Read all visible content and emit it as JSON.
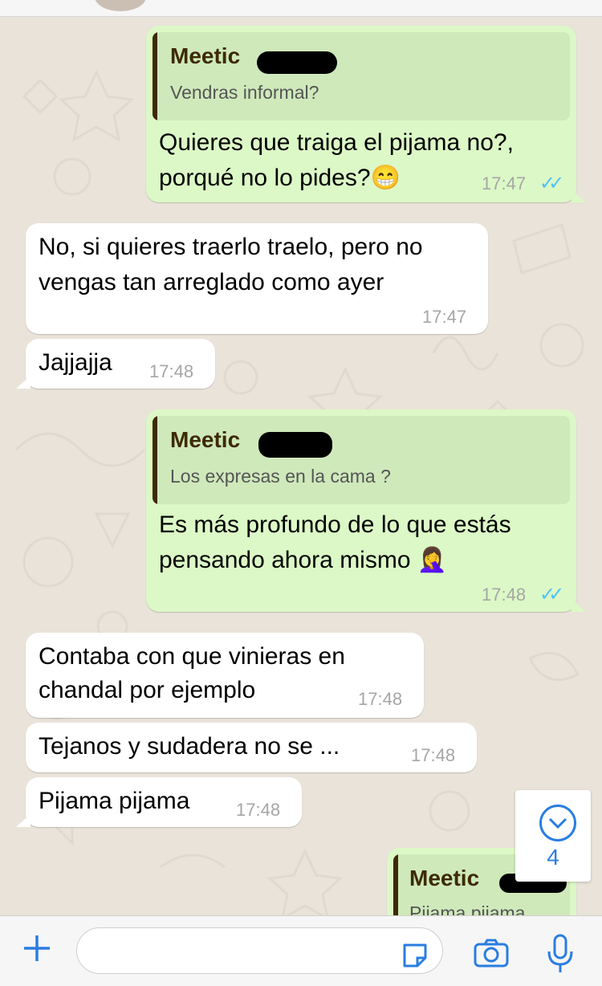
{
  "chat": {
    "messages": [
      {
        "direction": "out",
        "quote": {
          "author": "Meetic",
          "text": "Vendras informal?"
        },
        "lines": [
          "Quieres que traiga el pijama no?,",
          "porqué no lo pides?😁"
        ],
        "time": "17:47",
        "status_icon": "double-check-read"
      },
      {
        "direction": "in",
        "lines": [
          "No, si quieres traerlo traelo, pero no",
          "vengas tan arreglado como ayer"
        ],
        "time": "17:47"
      },
      {
        "direction": "in",
        "lines": [
          "Jajjajja"
        ],
        "time": "17:48"
      },
      {
        "direction": "out",
        "quote": {
          "author": "Meetic",
          "text": "Los expresas en la cama ?"
        },
        "lines": [
          "Es más profundo de lo que estás",
          "pensando ahora mismo 🤦‍♀️"
        ],
        "time": "17:48",
        "status_icon": "double-check-read"
      },
      {
        "direction": "in",
        "lines": [
          "Contaba con que vinieras en",
          "chandal por ejemplo"
        ],
        "time": "17:48"
      },
      {
        "direction": "in",
        "lines": [
          "Tejanos y sudadera no se ..."
        ],
        "time": "17:48"
      },
      {
        "direction": "in",
        "lines": [
          "Pijama pijama"
        ],
        "time": "17:48"
      },
      {
        "direction": "out",
        "quote": {
          "author": "Meetic",
          "text": "Pijama pijama"
        }
      }
    ],
    "scroll_down": {
      "icon": "chevron-down-icon",
      "unread_count": "4"
    },
    "colors": {
      "outgoing_bubble": "#dcf8c6",
      "incoming_bubble": "#ffffff",
      "read_ticks": "#4fc3f7",
      "accent": "#2a7de1"
    }
  },
  "input_bar": {
    "plus_icon": "plus-icon",
    "text_field_value": "",
    "sticker_icon": "sticker-icon",
    "camera_icon": "camera-icon",
    "mic_icon": "microphone-icon"
  }
}
